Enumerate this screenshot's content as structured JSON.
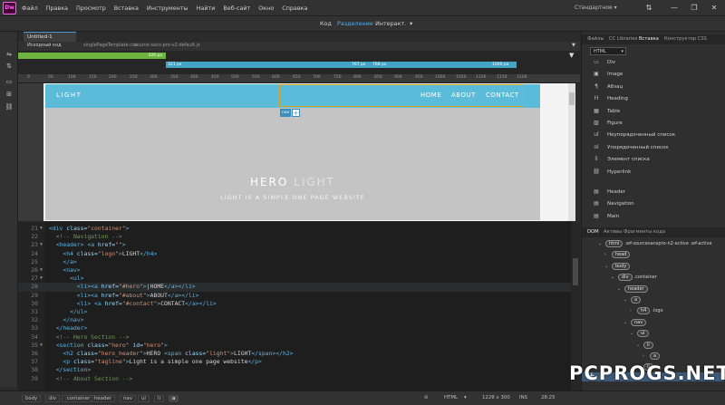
{
  "app": {
    "logo": "Dw"
  },
  "menu": [
    "Файл",
    "Правка",
    "Просмотр",
    "Вставка",
    "Инструменты",
    "Найти",
    "Веб-сайт",
    "Окно",
    "Справка"
  ],
  "workspace": {
    "label": "Стандартное"
  },
  "views": {
    "code": "Код",
    "split": "Разделение",
    "live": "Интеракт."
  },
  "doc": {
    "tab": "Untitled-1"
  },
  "related_files": [
    "Исходный код",
    "singlePageTemplate.css",
    "source-sans-pro-v2-default.js"
  ],
  "media_queries": {
    "green": "320 px",
    "b1": "321 px",
    "b2": "767 px",
    "b3": "768 px",
    "b4": "1000 px"
  },
  "ruler_ticks": [
    "0",
    "50",
    "100",
    "150",
    "200",
    "250",
    "300",
    "350",
    "400",
    "450",
    "500",
    "550",
    "600",
    "650",
    "700",
    "750",
    "800",
    "850",
    "900",
    "950",
    "1000",
    "1050",
    "1100",
    "1150",
    "1200"
  ],
  "site": {
    "logo": "LIGHT",
    "nav": [
      "HOME",
      "ABOUT",
      "CONTACT"
    ],
    "hero_title": "HERO",
    "hero_light": "LIGHT",
    "tagline": "LIGHT IS A SIMPLE ONE PAGE WEBSITE",
    "nav_badge": "nav",
    "nav_plus": "+"
  },
  "code": [
    {
      "n": "21",
      "f": "▼",
      "h": "<span class=\"tg\">&lt;div</span> <span class=\"at\">class=</span><span class=\"st\">\"container\"</span><span class=\"tg\">&gt;</span>"
    },
    {
      "n": "22",
      "f": "",
      "h": "  <span class=\"cm\">&lt;!-- Navigation --&gt;</span>"
    },
    {
      "n": "23",
      "f": "▼",
      "h": "  <span class=\"tg\">&lt;header&gt;</span> <span class=\"tg\">&lt;a</span> <span class=\"at\">href=</span><span class=\"st\">\"\"</span><span class=\"tg\">&gt;</span>"
    },
    {
      "n": "24",
      "f": "",
      "h": "    <span class=\"tg\">&lt;h4</span> <span class=\"at\">class=</span><span class=\"st\">\"logo\"</span><span class=\"tg\">&gt;</span>LIGHT<span class=\"tg\">&lt;/h4&gt;</span>"
    },
    {
      "n": "25",
      "f": "",
      "h": "    <span class=\"tg\">&lt;/a&gt;</span>"
    },
    {
      "n": "26",
      "f": "▼",
      "h": "    <span class=\"tg\">&lt;nav&gt;</span>"
    },
    {
      "n": "27",
      "f": "▼",
      "h": "      <span class=\"tg\">&lt;ul&gt;</span>"
    },
    {
      "n": "28",
      "f": "",
      "h": "        <span class=\"tg\">&lt;li&gt;&lt;a</span> <span class=\"at\">href=</span><span class=\"st\">\"#hero\"</span><span class=\"tg\">&gt;</span>|HOME<span class=\"tg\">&lt;/a&gt;&lt;/li&gt;</span>",
      "cur": true
    },
    {
      "n": "29",
      "f": "",
      "h": "        <span class=\"tg\">&lt;li&gt;&lt;a</span> <span class=\"at\">href=</span><span class=\"st\">\"#about\"</span><span class=\"tg\">&gt;</span>ABOUT<span class=\"tg\">&lt;/a&gt;&lt;/li&gt;</span>"
    },
    {
      "n": "30",
      "f": "",
      "h": "        <span class=\"tg\">&lt;li&gt;</span> <span class=\"tg\">&lt;a</span> <span class=\"at\">href=</span><span class=\"st\">\"#contact\"</span><span class=\"tg\">&gt;</span>CONTACT<span class=\"tg\">&lt;/a&gt;&lt;/li&gt;</span>"
    },
    {
      "n": "31",
      "f": "",
      "h": "      <span class=\"tg\">&lt;/ul&gt;</span>"
    },
    {
      "n": "32",
      "f": "",
      "h": "    <span class=\"tg\">&lt;/nav&gt;</span>"
    },
    {
      "n": "33",
      "f": "",
      "h": "  <span class=\"tg\">&lt;/header&gt;</span>"
    },
    {
      "n": "34",
      "f": "",
      "h": "  <span class=\"cm\">&lt;!-- Hero Section --&gt;</span>"
    },
    {
      "n": "35",
      "f": "▼",
      "h": "  <span class=\"tg\">&lt;section</span> <span class=\"at\">class=</span><span class=\"st\">\"hero\"</span> <span class=\"at\">id=</span><span class=\"st\">\"hero\"</span><span class=\"tg\">&gt;</span>"
    },
    {
      "n": "36",
      "f": "",
      "h": "    <span class=\"tg\">&lt;h2</span> <span class=\"at\">class=</span><span class=\"st\">\"hero_header\"</span><span class=\"tg\">&gt;</span>HERO <span class=\"tg\">&lt;span</span> <span class=\"at\">class=</span><span class=\"st\">\"light\"</span><span class=\"tg\">&gt;</span>LIGHT<span class=\"tg\">&lt;/span&gt;&lt;/h2&gt;</span>"
    },
    {
      "n": "37",
      "f": "",
      "h": "    <span class=\"tg\">&lt;p</span> <span class=\"at\">class=</span><span class=\"st\">\"tagline\"</span><span class=\"tg\">&gt;</span>Light is a simple one page website<span class=\"tg\">&lt;/p&gt;</span>"
    },
    {
      "n": "38",
      "f": "",
      "h": "  <span class=\"tg\">&lt;/section&gt;</span>"
    },
    {
      "n": "39",
      "f": "",
      "h": "  <span class=\"cm\">&lt;!-- About Section --&gt;</span>"
    }
  ],
  "status": {
    "crumbs": [
      "body",
      "div",
      ".container",
      "header",
      "nav",
      "ul",
      "li",
      "a"
    ],
    "lang": "HTML",
    "size": "1228 x 300",
    "mode": "INS",
    "pos": "28:25"
  },
  "right_tabs": [
    "Файлы",
    "CC Libraries",
    "Вставка",
    "Конструктор CSS"
  ],
  "insert_select": "HTML",
  "insert_items": [
    {
      "icon": "▭",
      "label": "Div"
    },
    {
      "icon": "▣",
      "label": "Image"
    },
    {
      "icon": "¶",
      "label": "Абзац"
    },
    {
      "icon": "H",
      "label": "Heading"
    },
    {
      "icon": "▦",
      "label": "Table"
    },
    {
      "icon": "▨",
      "label": "Figure"
    },
    {
      "icon": "ul",
      "label": "Неупорядоченный список"
    },
    {
      "icon": "ol",
      "label": "Упорядоченный список"
    },
    {
      "icon": "li",
      "label": "Элемент списка"
    },
    {
      "icon": "⛓",
      "label": "Hyperlink"
    },
    {
      "icon": "▤",
      "label": "Header"
    },
    {
      "icon": "▤",
      "label": "Navigation"
    },
    {
      "icon": "▤",
      "label": "Main"
    }
  ],
  "dom_tabs": [
    "DOM",
    "Активы",
    "Фрагменты кода"
  ],
  "dom_tree": [
    {
      "d": 0,
      "t": "html",
      "c": ".wf-sourcesanspro-n2-active .wf-active"
    },
    {
      "d": 1,
      "t": "head",
      "c": ""
    },
    {
      "d": 1,
      "t": "body",
      "c": ""
    },
    {
      "d": 2,
      "t": "div",
      "c": ".container"
    },
    {
      "d": 3,
      "t": "header",
      "c": ""
    },
    {
      "d": 4,
      "t": "a",
      "c": ""
    },
    {
      "d": 5,
      "t": "h4",
      "c": ".logo"
    },
    {
      "d": 4,
      "t": "nav",
      "c": ""
    },
    {
      "d": 5,
      "t": "ul",
      "c": ""
    },
    {
      "d": 6,
      "t": "li",
      "c": ""
    },
    {
      "d": 7,
      "t": "a",
      "c": ""
    },
    {
      "d": 6,
      "t": "li",
      "c": ""
    }
  ],
  "watermark": "PCPROGS.NET"
}
